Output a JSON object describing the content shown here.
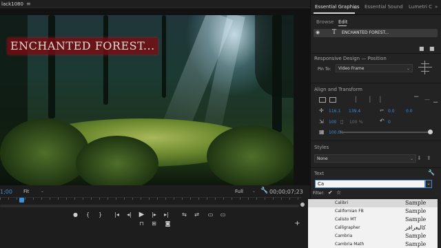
{
  "monitor": {
    "tab_title": "lack1080",
    "menu_icon": "hamburger-menu-icon",
    "overlay_title": "ENCHANTED FOREST...",
    "timecode_current": "1;00",
    "fit_value": "Fit",
    "quality_value": "Full",
    "timecode_total": "00;00;07;23",
    "transport": {
      "marker": "●",
      "in_point": "{",
      "out_point": "}",
      "go_to_in": "|◂",
      "step_back": "◂|",
      "play": "▶",
      "step_forward": "|▸",
      "go_to_out": "▸|",
      "insert": "⇆",
      "overwrite": "⇄",
      "export_frame": "▭",
      "lift": "⊓",
      "extract": "⊞",
      "camera": "◙",
      "add": "+"
    }
  },
  "panel": {
    "tabs": [
      {
        "label": "Essential Graphics",
        "active": true
      },
      {
        "label": "Essential Sound",
        "active": false
      },
      {
        "label": "Lumetri C",
        "active": false
      }
    ],
    "tab_menu_icon": "hamburger-menu-icon",
    "overflow": "»",
    "subtabs": [
      {
        "label": "Browse",
        "active": false
      },
      {
        "label": "Edit",
        "active": true
      }
    ],
    "layer": {
      "name": "ENCHANTED FOREST...",
      "type_icon": "T"
    },
    "responsive_label": "Responsive Design — Position",
    "pin_label": "Pin To:",
    "pin_value": "Video Frame",
    "align_label": "Align and Transform",
    "position_x": "116.1",
    "position_y": "139.4",
    "anchor_x": "0.0",
    "anchor_y": "0.0",
    "scale": "100",
    "scale_height": "100",
    "scale_unit": "%",
    "rotation": "0",
    "opacity": "100.0",
    "opacity_unit": "%",
    "opacity_level": 1.0,
    "styles_label": "Styles",
    "styles_value": "None",
    "text_label": "Text",
    "font_query": "Ca",
    "filter_label": "Filter:",
    "fonts": [
      {
        "name": "Calibri",
        "sample": "Sample",
        "selected": true
      },
      {
        "name": "Californian FB",
        "sample": "Sample",
        "selected": false
      },
      {
        "name": "Calisto MT",
        "sample": "Sample",
        "selected": false
      },
      {
        "name": "Calligrapher",
        "sample": "كاليغرافر",
        "selected": false
      },
      {
        "name": "Cambria",
        "sample": "Sample",
        "selected": false
      },
      {
        "name": "Cambria Math",
        "sample": "Sample",
        "selected": false
      }
    ]
  }
}
